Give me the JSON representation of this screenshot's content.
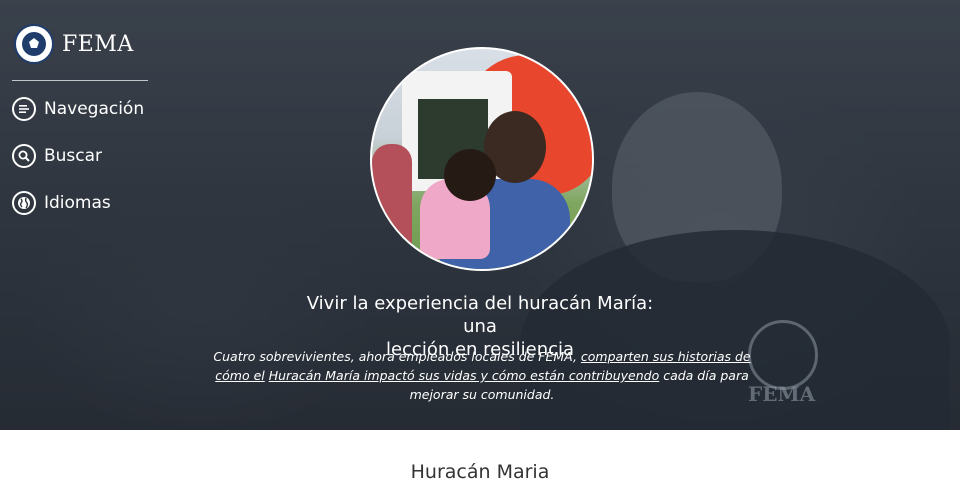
{
  "brand": {
    "name": "FEMA",
    "seal_icon": "dhs-seal-icon"
  },
  "nav": [
    {
      "label": "Navegación",
      "icon": "menu-icon"
    },
    {
      "label": "Buscar",
      "icon": "search-icon"
    },
    {
      "label": "Idiomas",
      "icon": "globe-icon"
    }
  ],
  "hero": {
    "headline_line1": "Vivir la experiencia del huracán María: una",
    "headline_line2": "lección en resiliencia",
    "desc_part1": "Cuatro sobrevivientes, ahora empleados locales de FEMA, ",
    "desc_link1": "comparten sus historias de cómo el",
    "desc_link2": "Huracán María impactó sus vidas y cómo están contribuyendo",
    "desc_part2": " cada día para mejorar su comunidad.",
    "background_text": "FEMA"
  },
  "section": {
    "title": "Huracán Maria"
  },
  "colors": {
    "overlay": "#2b3139",
    "text": "#ffffff",
    "section_title": "#333333"
  }
}
